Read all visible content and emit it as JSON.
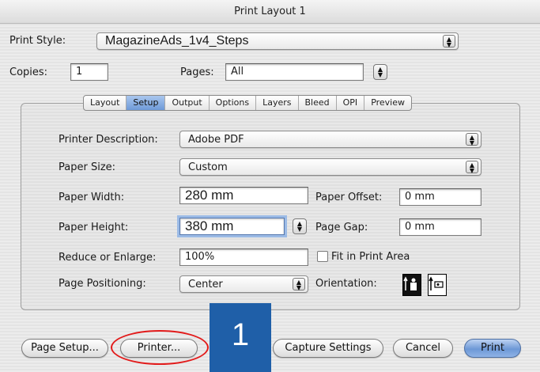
{
  "window": {
    "title": "Print Layout 1"
  },
  "print_style": {
    "label": "Print Style:",
    "value": "MagazineAds_1v4_Steps"
  },
  "copies": {
    "label": "Copies:",
    "value": "1"
  },
  "pages": {
    "label": "Pages:",
    "value": "All"
  },
  "tabs": [
    {
      "label": "Layout",
      "active": false
    },
    {
      "label": "Setup",
      "active": true
    },
    {
      "label": "Output",
      "active": false
    },
    {
      "label": "Options",
      "active": false
    },
    {
      "label": "Layers",
      "active": false
    },
    {
      "label": "Bleed",
      "active": false
    },
    {
      "label": "OPI",
      "active": false
    },
    {
      "label": "Preview",
      "active": false
    }
  ],
  "setup": {
    "printer_description": {
      "label": "Printer Description:",
      "value": "Adobe PDF"
    },
    "paper_size": {
      "label": "Paper Size:",
      "value": "Custom"
    },
    "paper_width": {
      "label": "Paper Width:",
      "value": "280 mm"
    },
    "paper_offset": {
      "label": "Paper Offset:",
      "value": "0 mm"
    },
    "paper_height": {
      "label": "Paper Height:",
      "value": "380 mm"
    },
    "page_gap": {
      "label": "Page Gap:",
      "value": "0 mm"
    },
    "reduce_enlarge": {
      "label": "Reduce or Enlarge:",
      "value": "100%"
    },
    "fit_in_print_area": {
      "label": "Fit in Print Area",
      "checked": false
    },
    "page_positioning": {
      "label": "Page Positioning:",
      "value": "Center"
    },
    "orientation": {
      "label": "Orientation:",
      "selected": "portrait"
    }
  },
  "buttons": {
    "page_setup": "Page Setup...",
    "printer": "Printer...",
    "capture_settings": "Capture Settings",
    "cancel": "Cancel",
    "print": "Print"
  },
  "step_badge": "1",
  "colors": {
    "accent": "#1f5fa8",
    "highlight": "#e21b1b",
    "default_button": "#6d98d6"
  }
}
